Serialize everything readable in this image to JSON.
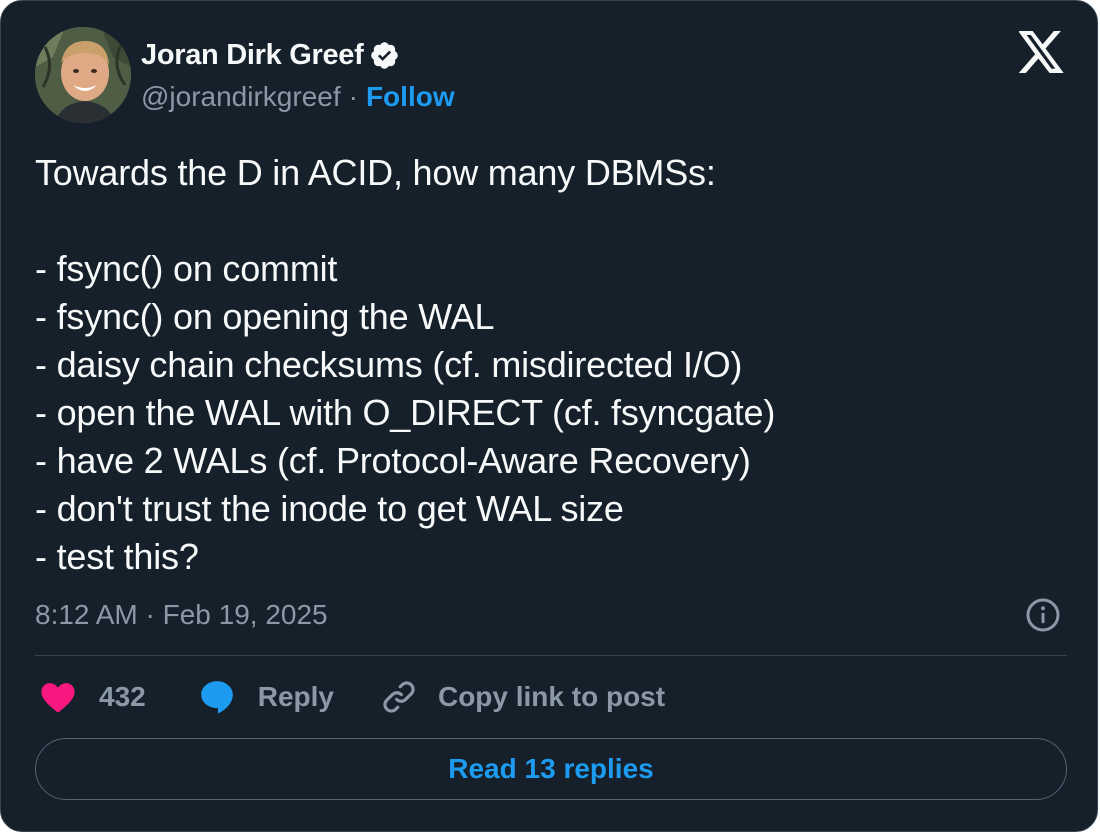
{
  "author": {
    "display_name": "Joran Dirk Greef",
    "handle": "@jorandirkgreef",
    "separator": "·",
    "follow_label": "Follow",
    "avatar_icon": "avatar-photo",
    "verified_icon": "verified-badge-icon"
  },
  "platform_icon": "x-logo-icon",
  "tweet": {
    "text": "Towards the D in ACID, how many DBMSs:\n\n- fsync() on commit\n- fsync() on opening the WAL\n- daisy chain checksums (cf. misdirected I/O)\n- open the WAL with O_DIRECT (cf. fsyncgate)\n- have 2 WALs (cf. Protocol-Aware Recovery)\n- don't trust the inode to get WAL size\n- test this?",
    "timestamp": "8:12 AM · Feb 19, 2025"
  },
  "actions": {
    "like_count": "432",
    "reply_label": "Reply",
    "copy_link_label": "Copy link to post"
  },
  "read_replies_label": "Read 13 replies",
  "colors": {
    "background": "#15202b",
    "text_primary": "#f7f9f9",
    "text_secondary": "#8b98a5",
    "accent": "#1d9bf0",
    "like": "#f91880",
    "border": "#38444d"
  }
}
